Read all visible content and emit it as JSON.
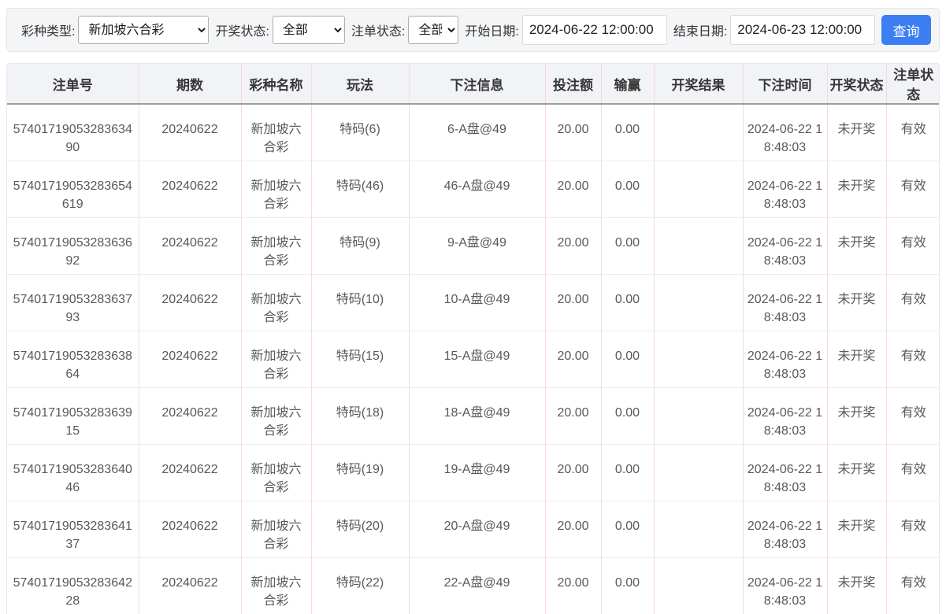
{
  "filter_bar": {
    "lottery_type_label": "彩种类型:",
    "lottery_type_value": "新加坡六合彩",
    "draw_status_label": "开奖状态:",
    "draw_status_value": "全部",
    "order_status_label": "注单状态:",
    "order_status_value": "全部",
    "start_date_label": "开始日期:",
    "start_date_value": "2024-06-22 12:00:00",
    "end_date_label": "结束日期:",
    "end_date_value": "2024-06-23 12:00:00",
    "query_button_label": "查询"
  },
  "colors": {
    "accent_button": "#3b7ff2",
    "header_bg": "#f1f3f6",
    "panel_bg": "#f4f5f7",
    "cell_divider_pink": "#f8d8d8",
    "row_divider_gray": "#ececec"
  },
  "table": {
    "columns": [
      "注单号",
      "期数",
      "彩种名称",
      "玩法",
      "下注信息",
      "投注额",
      "输赢",
      "开奖结果",
      "下注时间",
      "开奖状态",
      "注单状态"
    ],
    "rows": [
      [
        "5740171905328363490",
        "20240622",
        "新加坡六合彩",
        "特码(6)",
        "6-A盘@49",
        "20.00",
        "0.00",
        "",
        "2024-06-22 18:48:03",
        "未开奖",
        "有效"
      ],
      [
        "57401719053283654619",
        "20240622",
        "新加坡六合彩",
        "特码(46)",
        "46-A盘@49",
        "20.00",
        "0.00",
        "",
        "2024-06-22 18:48:03",
        "未开奖",
        "有效"
      ],
      [
        "5740171905328363692",
        "20240622",
        "新加坡六合彩",
        "特码(9)",
        "9-A盘@49",
        "20.00",
        "0.00",
        "",
        "2024-06-22 18:48:03",
        "未开奖",
        "有效"
      ],
      [
        "5740171905328363793",
        "20240622",
        "新加坡六合彩",
        "特码(10)",
        "10-A盘@49",
        "20.00",
        "0.00",
        "",
        "2024-06-22 18:48:03",
        "未开奖",
        "有效"
      ],
      [
        "5740171905328363864",
        "20240622",
        "新加坡六合彩",
        "特码(15)",
        "15-A盘@49",
        "20.00",
        "0.00",
        "",
        "2024-06-22 18:48:03",
        "未开奖",
        "有效"
      ],
      [
        "5740171905328363915",
        "20240622",
        "新加坡六合彩",
        "特码(18)",
        "18-A盘@49",
        "20.00",
        "0.00",
        "",
        "2024-06-22 18:48:03",
        "未开奖",
        "有效"
      ],
      [
        "5740171905328364046",
        "20240622",
        "新加坡六合彩",
        "特码(19)",
        "19-A盘@49",
        "20.00",
        "0.00",
        "",
        "2024-06-22 18:48:03",
        "未开奖",
        "有效"
      ],
      [
        "5740171905328364137",
        "20240622",
        "新加坡六合彩",
        "特码(20)",
        "20-A盘@49",
        "20.00",
        "0.00",
        "",
        "2024-06-22 18:48:03",
        "未开奖",
        "有效"
      ],
      [
        "5740171905328364228",
        "20240622",
        "新加坡六合彩",
        "特码(22)",
        "22-A盘@49",
        "20.00",
        "0.00",
        "",
        "2024-06-22 18:48:03",
        "未开奖",
        "有效"
      ]
    ]
  }
}
